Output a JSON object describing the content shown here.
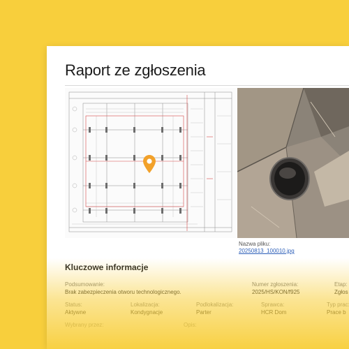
{
  "report": {
    "title": "Raport ze zgłoszenia",
    "file_label": "Nazwa pliku:",
    "file_name": "20250813_100010.jpg"
  },
  "key_info": {
    "heading": "Kluczowe informacje",
    "summary": {
      "label": "Podsumowanie:",
      "value": "Brak zabezpieczenia otworu technologicznego."
    },
    "ticket_number": {
      "label": "Numer zgłoszenia:",
      "value": "2025/HS/KON/f925"
    },
    "stage": {
      "label": "Etap:",
      "value": "Zgłos"
    },
    "status": {
      "label": "Status:",
      "value": "Aktywne"
    },
    "location": {
      "label": "Lokalizacja:",
      "value": "Kondygnacje"
    },
    "sublocation": {
      "label": "Podlokalizacja:",
      "value": "Parter"
    },
    "assignee": {
      "label": "Sprawca:",
      "value": "HCR Dom"
    },
    "type": {
      "label": "Typ prac:",
      "value": "Prace b"
    },
    "selected_by": {
      "label": "Wybrany przez:",
      "value": ""
    },
    "description": {
      "label": "Opis:",
      "value": ""
    }
  },
  "icons": {
    "location_pin": "map-pin-icon"
  },
  "colors": {
    "background": "#f8cf3c",
    "pin": "#f2a12a",
    "link": "#2d5fb8"
  }
}
